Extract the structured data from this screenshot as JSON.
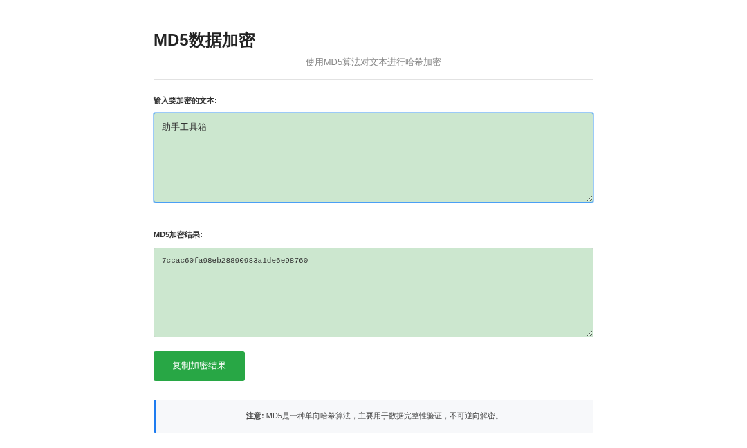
{
  "title": "MD5数据加密",
  "subtitle": "使用MD5算法对文本进行哈希加密",
  "input": {
    "label": "输入要加密的文本:",
    "value": "助手工具箱",
    "focused": true
  },
  "output": {
    "label": "MD5加密结果:",
    "value": "7ccac60fa98eb28890983a1de6e98760",
    "focused": false
  },
  "copy_button": "复制加密结果",
  "note": "**注意:** MD5是一种单向哈希算法，主要用于数据完整性验证，不可逆向解密。"
}
